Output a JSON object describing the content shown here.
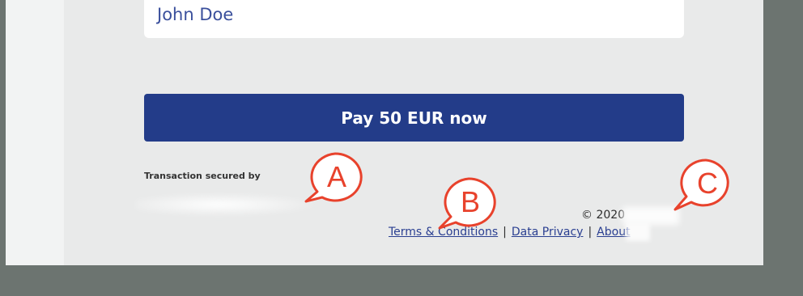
{
  "form": {
    "name_value": "John Doe",
    "pay_button_label": "Pay 50 EUR now"
  },
  "footer": {
    "secured_label": "Transaction secured by",
    "copyright": "© 2020",
    "links": {
      "terms": "Terms & Conditions",
      "privacy": "Data Privacy",
      "about": "About"
    },
    "separator": "|"
  },
  "callouts": {
    "a": "A",
    "b": "B",
    "c": "C",
    "color": "#e8422c"
  },
  "colors": {
    "primary": "#233c89",
    "link": "#2a3f91",
    "page_bg": "#e9eaea",
    "outer_bg": "#6c7470"
  }
}
